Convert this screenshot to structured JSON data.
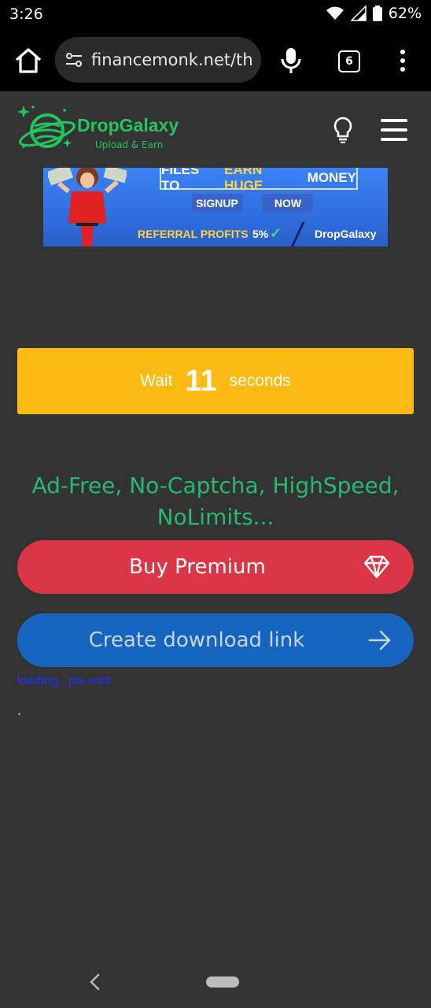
{
  "status_bar": {
    "time": "3:26",
    "battery": "62%"
  },
  "browser": {
    "url": "financemonk.net/th",
    "tab_count": "6"
  },
  "site": {
    "brand_name": "DropGalaxy",
    "brand_tagline": "Upload & Earn",
    "brand_color": "#22c55e"
  },
  "ad": {
    "headline_start": "FILES TO",
    "headline_highlight": "EARN HUGE",
    "headline_end": "MONEY",
    "signup": "SIGNUP",
    "now": "NOW",
    "referral": "REFERRAL PROFITS",
    "percent": "5%",
    "brand": "DropGalaxy"
  },
  "countdown": {
    "prefix": "Wait",
    "seconds": "11",
    "suffix": "seconds"
  },
  "tagline": "Ad-Free, No-Captcha, HighSpeed, NoLimits...",
  "buttons": {
    "premium": "Buy Premium",
    "download": "Create download link"
  },
  "loading_text": "loading.. pls wait",
  "dot": ".",
  "colors": {
    "wait_bg": "#fdba12",
    "premium_bg": "#dc3545",
    "download_bg": "#1565c0",
    "tagline": "#27b973"
  }
}
